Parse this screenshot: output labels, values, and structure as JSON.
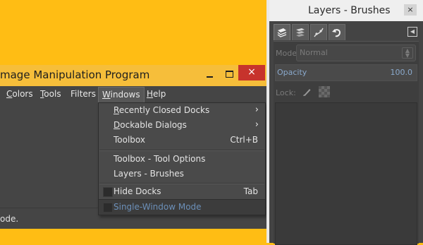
{
  "gimp_window": {
    "title": "mage Manipulation Program",
    "close_glyph": "×",
    "status_text": "ode."
  },
  "menubar": {
    "colors": "Colors",
    "tools": "Tools",
    "filters": "Filters",
    "windows": "Windows",
    "help": "Help"
  },
  "windows_menu": {
    "recently_closed_docks": "Recently Closed Docks",
    "dockable_dialogs": "Dockable Dialogs",
    "toolbox": "Toolbox",
    "toolbox_shortcut": "Ctrl+B",
    "toolbox_tool_options": "Toolbox - Tool Options",
    "layers_brushes": "Layers - Brushes",
    "hide_docks": "Hide Docks",
    "hide_docks_shortcut": "Tab",
    "single_window_mode": "Single-Window Mode",
    "submenu_arrow": "›"
  },
  "dock": {
    "title": "Layers - Brushes",
    "close_glyph": "×",
    "menu_glyph": "◀",
    "mode_label": "Mode",
    "mode_value": "Normal",
    "opacity_label": "Opacity",
    "opacity_value": "100.0",
    "lock_label": "Lock:",
    "tabs": [
      "layers-icon",
      "channels-icon",
      "paths-icon",
      "undo-history-icon"
    ]
  },
  "colors": {
    "desktop": "#FFBD14",
    "menu_bg": "#4a4a4a",
    "highlight_text": "#6b8fb8",
    "close_red": "#C7332C"
  }
}
